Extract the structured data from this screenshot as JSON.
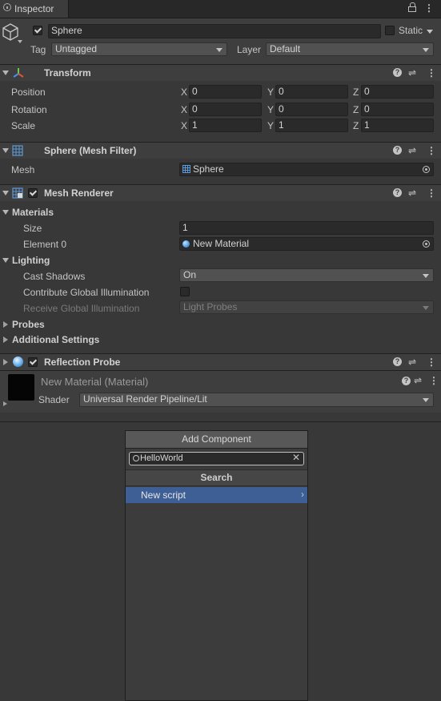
{
  "window": {
    "tab_label": "Inspector",
    "lock_icon": "lock-icon",
    "menu_icon": "kebab-icon"
  },
  "gameobject": {
    "name": "Sphere",
    "active": true,
    "static_label": "Static",
    "tag_label": "Tag",
    "tag_value": "Untagged",
    "layer_label": "Layer",
    "layer_value": "Default"
  },
  "transform": {
    "title": "Transform",
    "rows": [
      {
        "label": "Position",
        "x": "0",
        "y": "0",
        "z": "0"
      },
      {
        "label": "Rotation",
        "x": "0",
        "y": "0",
        "z": "0"
      },
      {
        "label": "Scale",
        "x": "1",
        "y": "1",
        "z": "1"
      }
    ],
    "axis": {
      "x": "X",
      "y": "Y",
      "z": "Z"
    }
  },
  "mesh_filter": {
    "title": "Sphere (Mesh Filter)",
    "mesh_label": "Mesh",
    "mesh_value": "Sphere"
  },
  "mesh_renderer": {
    "title": "Mesh Renderer",
    "enabled": true,
    "materials_label": "Materials",
    "size_label": "Size",
    "size_value": "1",
    "element_label": "Element 0",
    "element_value": "New Material",
    "lighting_label": "Lighting",
    "cast_shadows_label": "Cast Shadows",
    "cast_shadows_value": "On",
    "contribute_gi_label": "Contribute Global Illumination",
    "receive_gi_label": "Receive Global Illumination",
    "receive_gi_value": "Light Probes",
    "probes_label": "Probes",
    "additional_label": "Additional Settings"
  },
  "reflection_probe": {
    "title": "Reflection Probe",
    "enabled": true
  },
  "material": {
    "title": "New Material (Material)",
    "shader_label": "Shader",
    "shader_value": "Universal Render Pipeline/Lit"
  },
  "add_component": {
    "button_label": "Add Component",
    "search_value": "HelloWorld",
    "section_title": "Search",
    "items": [
      {
        "label": "New script",
        "selected": true
      }
    ]
  },
  "colors": {
    "selected": "#3e5f96",
    "panel": "#383838",
    "header": "#3e3e3e"
  }
}
